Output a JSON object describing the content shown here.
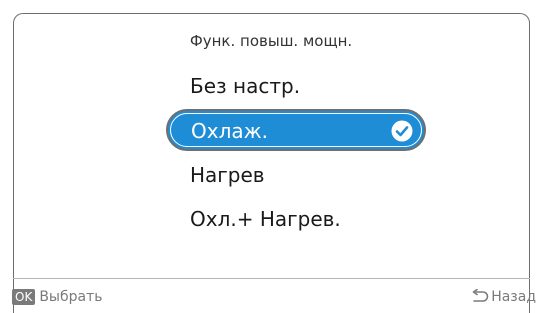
{
  "title": "Функ. повыш. мощн.",
  "options": [
    {
      "label": "Без настр.",
      "selected": false
    },
    {
      "label": "Охлаж.",
      "selected": true
    },
    {
      "label": "Нагрев",
      "selected": false
    },
    {
      "label": "Охл.+ Нагрев.",
      "selected": false
    }
  ],
  "footer": {
    "ok_key": "OK",
    "select_label": "Выбрать",
    "back_label": "Назад"
  },
  "colors": {
    "selection": "#1f8dd6",
    "text": "#1a1a1a",
    "muted": "#7a7a7a"
  },
  "icons": {
    "selected_check": "check-circle-icon",
    "back": "back-arrow-icon"
  }
}
